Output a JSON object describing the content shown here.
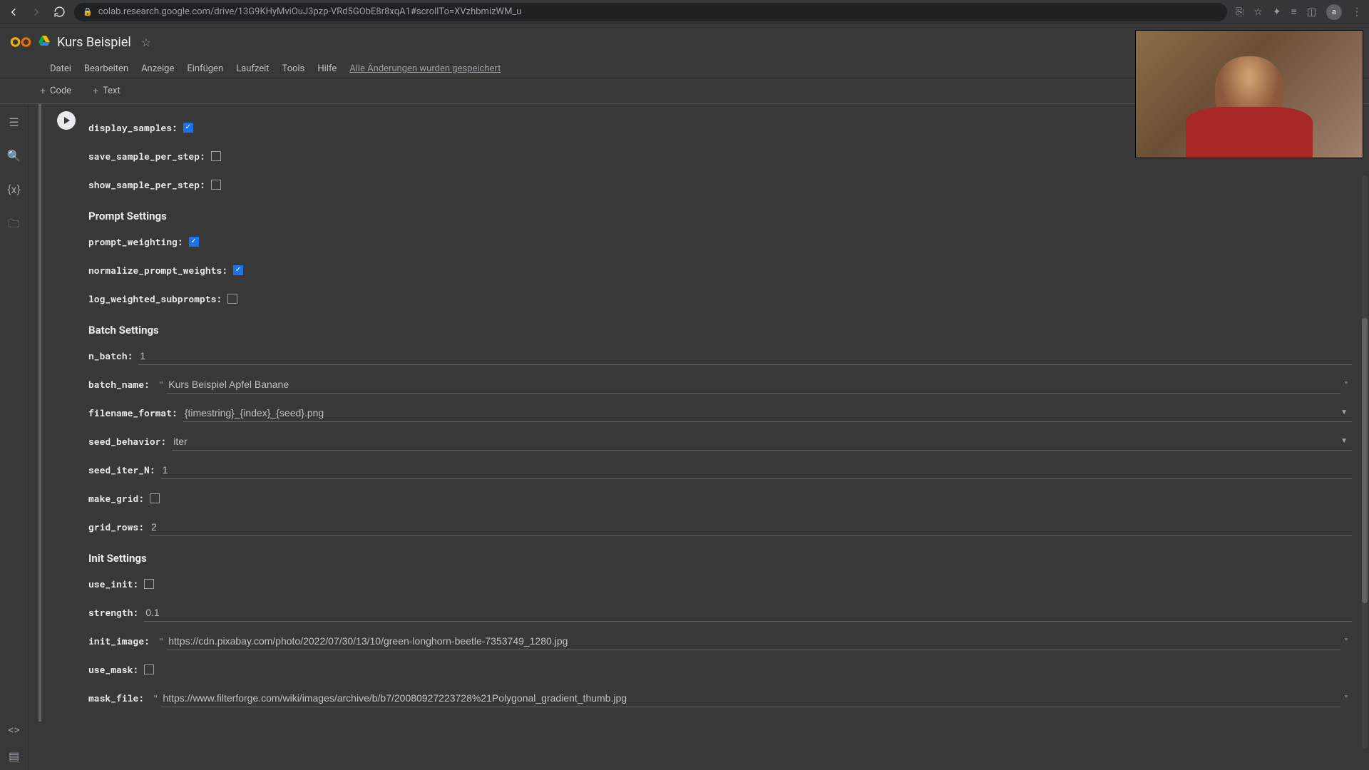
{
  "browser": {
    "url": "colab.research.google.com/drive/13G9KHyMviOuJ3pzp-VRd5GObE8r8xqA1#scrollTo=XVzhbmizWM_u"
  },
  "header": {
    "doc_title": "Kurs Beispiel"
  },
  "menu": {
    "items": [
      "Datei",
      "Bearbeiten",
      "Anzeige",
      "Einfügen",
      "Laufzeit",
      "Tools",
      "Hilfe"
    ],
    "saved_text": "Alle Änderungen wurden gespeichert"
  },
  "toolbar": {
    "code_label": "Code",
    "text_label": "Text"
  },
  "form": {
    "display_samples": {
      "label": "display_samples:",
      "checked": true
    },
    "save_sample_per_step": {
      "label": "save_sample_per_step:",
      "checked": false
    },
    "show_sample_per_step": {
      "label": "show_sample_per_step:",
      "checked": false
    },
    "section_prompt": "Prompt Settings",
    "prompt_weighting": {
      "label": "prompt_weighting:",
      "checked": true
    },
    "normalize_prompt_weights": {
      "label": "normalize_prompt_weights:",
      "checked": true
    },
    "log_weighted_subprompts": {
      "label": "log_weighted_subprompts:",
      "checked": false
    },
    "section_batch": "Batch Settings",
    "n_batch": {
      "label": "n_batch:",
      "value": "1"
    },
    "batch_name": {
      "label": "batch_name:",
      "value": "Kurs Beispiel Apfel Banane"
    },
    "filename_format": {
      "label": "filename_format:",
      "value": "{timestring}_{index}_{seed}.png"
    },
    "seed_behavior": {
      "label": "seed_behavior:",
      "value": "iter"
    },
    "seed_iter_N": {
      "label": "seed_iter_N:",
      "value": "1"
    },
    "make_grid": {
      "label": "make_grid:",
      "checked": false
    },
    "grid_rows": {
      "label": "grid_rows:",
      "value": "2"
    },
    "section_init": "Init Settings",
    "use_init": {
      "label": "use_init:",
      "checked": false
    },
    "strength": {
      "label": "strength:",
      "value": "0.1"
    },
    "init_image": {
      "label": "init_image:",
      "value": "https://cdn.pixabay.com/photo/2022/07/30/13/10/green-longhorn-beetle-7353749_1280.jpg"
    },
    "use_mask": {
      "label": "use_mask:",
      "checked": false
    },
    "mask_file": {
      "label": "mask_file:",
      "value": "https://www.filterforge.com/wiki/images/archive/b/b7/20080927223728%21Polygonal_gradient_thumb.jpg"
    }
  }
}
